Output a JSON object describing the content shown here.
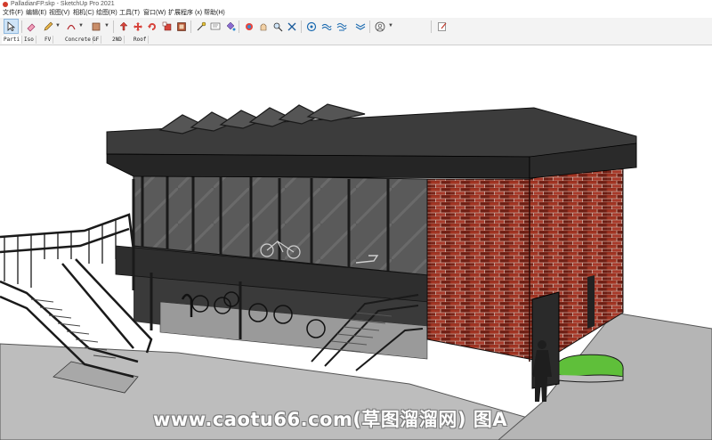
{
  "window": {
    "title": "PalladianFP.skp - SketchUp Pro 2021"
  },
  "menu": [
    "文件(F)",
    "编辑(E)",
    "视图(V)",
    "相机(C)",
    "绘图(R)",
    "工具(T)",
    "窗口(W)",
    "扩展程序 (x)",
    "帮助(H)"
  ],
  "toolbar": {
    "icons": [
      "select-icon",
      "eraser-icon",
      "pencil-icon",
      "arc-icon",
      "rectangle-icon",
      "push-pull-icon",
      "move-icon",
      "rotate-icon",
      "scale-icon",
      "tape-measure-icon",
      "text-icon",
      "paint-bucket-icon",
      "orbit-icon",
      "pan-icon",
      "zoom-icon",
      "zoom-extents-icon",
      "warehouse-icon",
      "extension-warehouse-icon",
      "send-to-layout-icon",
      "account-icon",
      "style-icon"
    ]
  },
  "scenes": [
    "Parti",
    "Iso",
    "FV",
    "Concrete",
    "GF",
    "2ND",
    "Roof"
  ],
  "watermark": "www.caotu66.com(草图溜溜网) 图A"
}
